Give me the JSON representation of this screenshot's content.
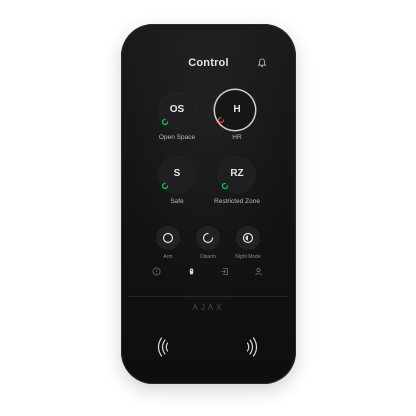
{
  "header": {
    "title": "Control",
    "bell_icon": "bell-icon"
  },
  "groups": [
    {
      "abbr": "OS",
      "label": "Open Space",
      "status_color": "#27c24c",
      "active": false
    },
    {
      "abbr": "H",
      "label": "HR",
      "status_color": "#e0473a",
      "active": true
    },
    {
      "abbr": "S",
      "label": "Safe",
      "status_color": "#27c24c",
      "active": false
    },
    {
      "abbr": "RZ",
      "label": "Restricted Zone",
      "status_color": "#27c24c",
      "active": false
    }
  ],
  "modes": [
    {
      "label": "Arm",
      "icon": "arm-icon"
    },
    {
      "label": "Disarm",
      "icon": "disarm-icon"
    },
    {
      "label": "Night Mode",
      "icon": "night-mode-icon"
    }
  ],
  "tabbar": [
    "alert-icon",
    "key-icon",
    "login-icon",
    "user-icon"
  ],
  "brand": {
    "logo": "AJAX"
  },
  "nfc": [
    "nfc-left-icon",
    "nfc-right-icon"
  ]
}
